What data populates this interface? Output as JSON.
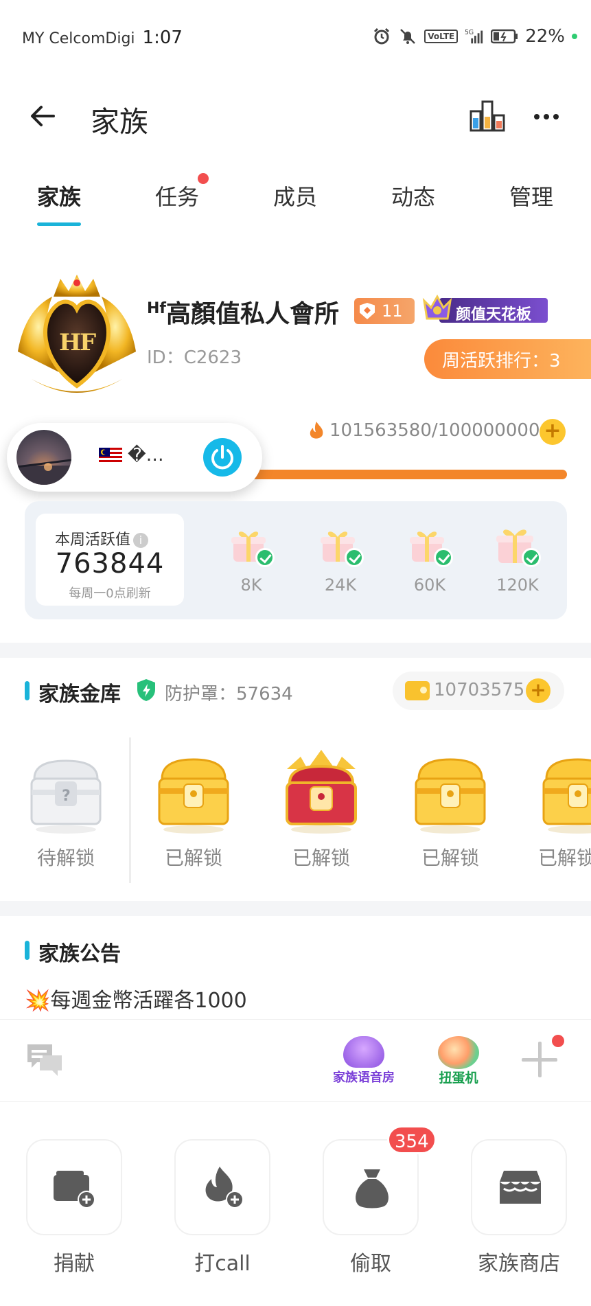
{
  "status_bar": {
    "carrier": "MY CelcomDigi",
    "time": "1:07",
    "volte": "VoLTE",
    "battery": "22%"
  },
  "header": {
    "title": "家族"
  },
  "tabs": [
    {
      "label": "家族",
      "active": true
    },
    {
      "label": "任务",
      "dot": true
    },
    {
      "label": "成员"
    },
    {
      "label": "动态"
    },
    {
      "label": "管理"
    }
  ],
  "family": {
    "name_prefix": "Hf",
    "name": "高顏值私人會所",
    "level": "11",
    "title_badge": "颜值天花板",
    "id": "ID：C2623",
    "weekly_rank": "周活跃排行：3",
    "progress_text": "101563580/100000000"
  },
  "mini_player": {
    "text": "�…"
  },
  "weekly_activity": {
    "label": "本周活跃值",
    "value": "763844",
    "sub": "每周一0点刷新",
    "milestones": [
      "8K",
      "24K",
      "60K",
      "120K"
    ]
  },
  "treasury": {
    "title": "家族金库",
    "protection": "防护罩：57634",
    "coins": "10703575",
    "chests": [
      {
        "label": "待解锁",
        "state": "locked"
      },
      {
        "label": "已解锁",
        "state": "unlocked"
      },
      {
        "label": "已解锁",
        "state": "special"
      },
      {
        "label": "已解锁",
        "state": "unlocked"
      },
      {
        "label": "已解锁",
        "state": "unlocked"
      }
    ]
  },
  "announcement": {
    "title": "家族公告",
    "lines": [
      "💥每週金幣活躍各1000"
    ]
  },
  "toolbar": {
    "voice_room": "家族语音房",
    "gacha": "扭蛋机"
  },
  "actions": [
    {
      "label": "捐献"
    },
    {
      "label": "打call"
    },
    {
      "label": "偷取",
      "badge": "354"
    },
    {
      "label": "家族商店"
    }
  ],
  "colors": {
    "accent": "#1ab3d9",
    "orange": "#f3862a",
    "badge_red": "#f24e4e",
    "gold": "#fcc62e"
  }
}
